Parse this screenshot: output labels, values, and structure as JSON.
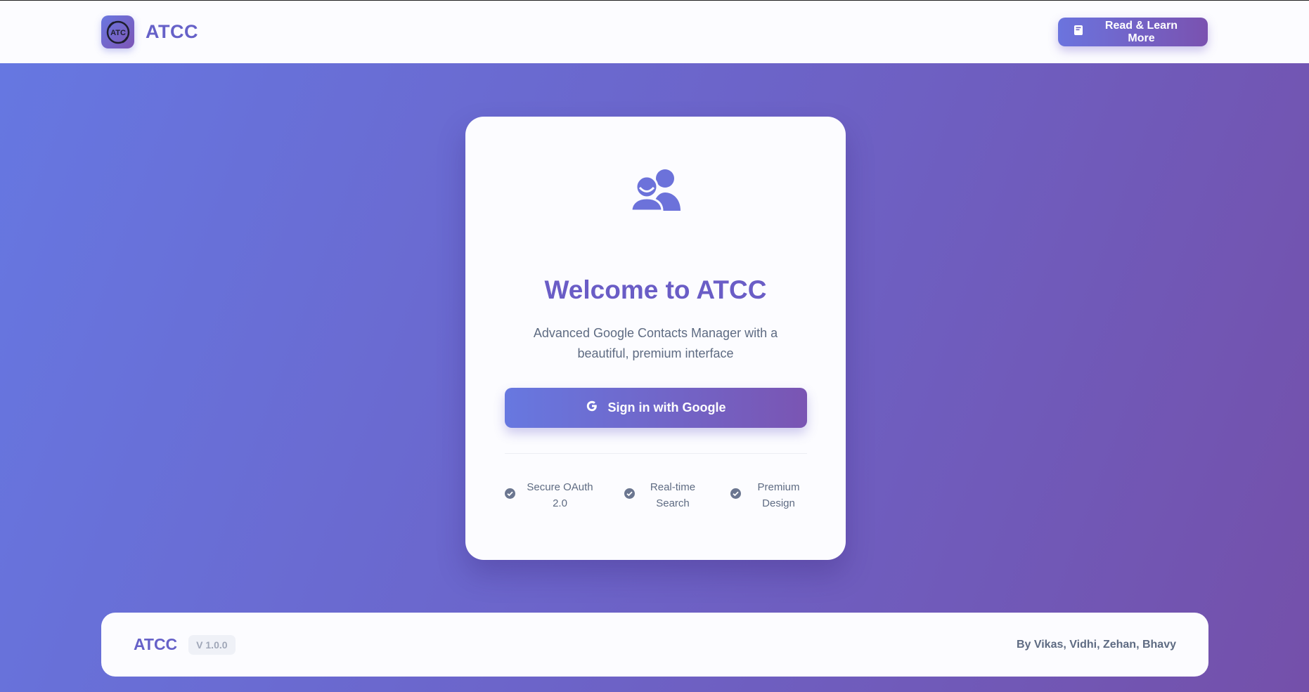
{
  "header": {
    "brand": "ATCC",
    "logo_text": "ATC",
    "learn_button_label": "Read & Learn More"
  },
  "card": {
    "icon": "users-icon",
    "title": "Welcome to ATCC",
    "subtitle": "Advanced Google Contacts Manager with a beautiful, premium interface",
    "signin_label": "Sign in with Google",
    "features": [
      {
        "label": "Secure OAuth 2.0",
        "icon": "check-circle-icon"
      },
      {
        "label": "Real-time Search",
        "icon": "check-circle-icon"
      },
      {
        "label": "Premium Design",
        "icon": "check-circle-icon"
      }
    ]
  },
  "footer": {
    "brand": "ATCC",
    "version": "V 1.0.0",
    "credits": "By Vikas, Vidhi, Zehan, Bhavy"
  },
  "colors": {
    "accent": "#6661c8",
    "gradient_start": "#6678e2",
    "gradient_end": "#7450aa",
    "muted_text": "#5e6b82"
  }
}
